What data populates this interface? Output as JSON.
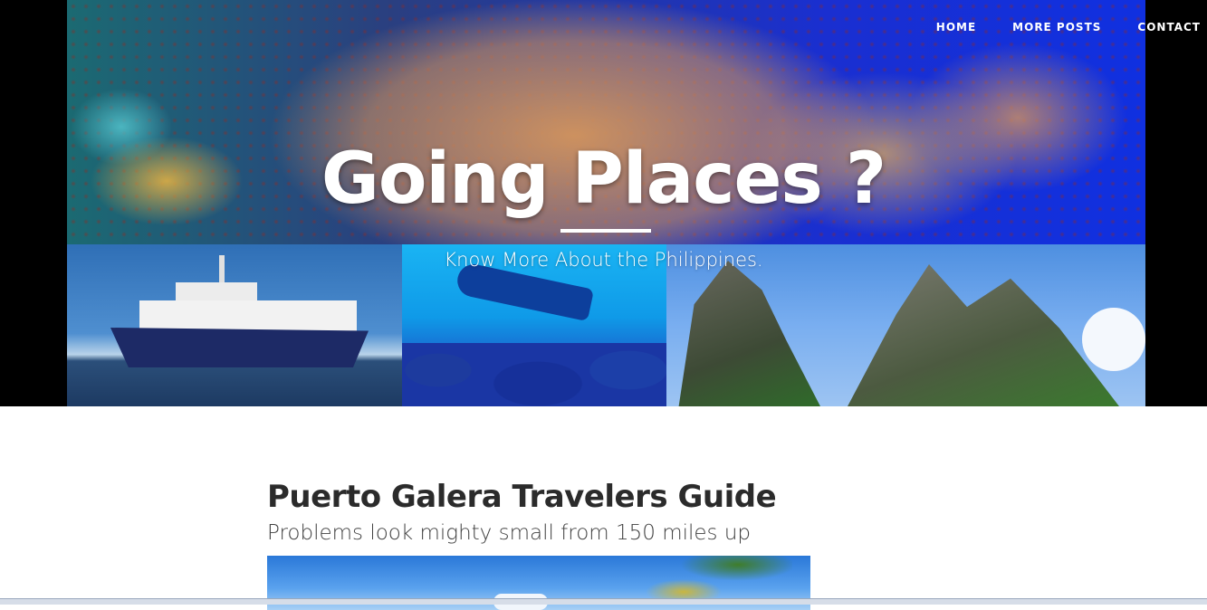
{
  "nav": {
    "items": [
      {
        "label": "HOME"
      },
      {
        "label": "MORE POSTS"
      },
      {
        "label": "CONTACT"
      }
    ]
  },
  "hero": {
    "title": "Going Places ?",
    "subtitle": "Know More About the Philippines."
  },
  "post": {
    "title": "Puerto Galera Travelers Guide",
    "subtitle": "Problems look mighty small from 150 miles up"
  },
  "colors": {
    "text_dark": "#2b2b2b",
    "hero_text": "#ffffff"
  }
}
